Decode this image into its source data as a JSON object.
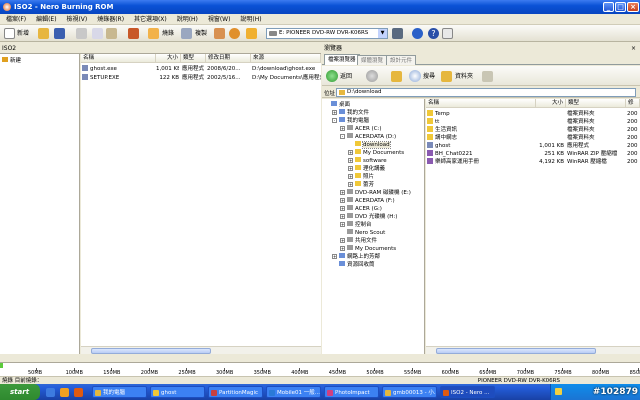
{
  "window": {
    "title": "ISO2 - Nero Burning ROM"
  },
  "menu": [
    "檔案(F)",
    "編輯(E)",
    "檢視(V)",
    "燒錄器(R)",
    "其它選項(X)",
    "說明(H)",
    "視窗(W)",
    "說明(H)"
  ],
  "toolbar": {
    "new_label": "新增",
    "burn_label": "燒錄",
    "copy_label": "複製",
    "drive": "E: PIONEER DVD-RW DVR-K06RS"
  },
  "compilation": {
    "header": "ISO2",
    "tree_root": "新建",
    "columns": [
      "名稱",
      "大小",
      "類型",
      "修改日期",
      "來源"
    ],
    "rows": [
      {
        "name": "ghost.exe",
        "size": "1,001 KB",
        "type": "應用程式",
        "date": "2008/6/20...",
        "source": "D:\\download\\ghost.exe"
      },
      {
        "name": "SETUP.EXE",
        "size": "122 KB",
        "type": "應用程式",
        "date": "2002/5/16...",
        "source": "D:\\My Documents\\應用程式"
      }
    ]
  },
  "browser": {
    "header": "瀏覽器",
    "tabs": [
      "檔案瀏覽器",
      "媒體瀏覽",
      "設計元件"
    ],
    "back_label": "返回",
    "search_label": "搜尋",
    "folders_label": "資料夾",
    "address_label": "位址",
    "address": "D:\\download",
    "tree": [
      {
        "label": "桌面",
        "level": 0,
        "exp": ""
      },
      {
        "label": "我的文件",
        "level": 1,
        "exp": "+"
      },
      {
        "label": "我的電腦",
        "level": 1,
        "exp": "-"
      },
      {
        "label": "ACER (C:)",
        "level": 2,
        "exp": "+"
      },
      {
        "label": "ACERDATA (D:)",
        "level": 2,
        "exp": "-"
      },
      {
        "label": "download",
        "level": 3,
        "exp": "",
        "sel": true
      },
      {
        "label": "My Documents",
        "level": 3,
        "exp": "+"
      },
      {
        "label": "software",
        "level": 3,
        "exp": "+"
      },
      {
        "label": "理化講義",
        "level": 3,
        "exp": "+"
      },
      {
        "label": "照片",
        "level": 3,
        "exp": "+"
      },
      {
        "label": "蕾芳",
        "level": 3,
        "exp": "+"
      },
      {
        "label": "DVD-RAM 磁碟機 (E:)",
        "level": 2,
        "exp": "+"
      },
      {
        "label": "ACERDATA (F:)",
        "level": 2,
        "exp": "+"
      },
      {
        "label": "ACER (G:)",
        "level": 2,
        "exp": "+"
      },
      {
        "label": "DVD 光碟機 (H:)",
        "level": 2,
        "exp": "+"
      },
      {
        "label": "控制台",
        "level": 2,
        "exp": "+"
      },
      {
        "label": "Nero Scout",
        "level": 2,
        "exp": ""
      },
      {
        "label": "共用文件",
        "level": 2,
        "exp": "+"
      },
      {
        "label": "My Documents",
        "level": 2,
        "exp": "+"
      },
      {
        "label": "網路上的芳鄰",
        "level": 1,
        "exp": "+"
      },
      {
        "label": "資源回收筒",
        "level": 1,
        "exp": ""
      }
    ],
    "columns": [
      "名稱",
      "大小",
      "類型",
      "修"
    ],
    "files": [
      {
        "name": "Temp",
        "size": "",
        "type": "檔案資料夾",
        "m": "200",
        "kind": "folder"
      },
      {
        "name": "tt",
        "size": "",
        "type": "檔案資料夾",
        "m": "200",
        "kind": "folder"
      },
      {
        "name": "生活資訊",
        "size": "",
        "type": "檔案資料夾",
        "m": "200",
        "kind": "folder"
      },
      {
        "name": "講中網志",
        "size": "",
        "type": "檔案資料夾",
        "m": "200",
        "kind": "folder"
      },
      {
        "name": "ghost",
        "size": "1,001 KB",
        "type": "應用程式",
        "m": "200",
        "kind": "exe"
      },
      {
        "name": "BH_Chat0221",
        "size": "251 KB",
        "type": "WinRAR ZIP 壓縮檔",
        "m": "200",
        "kind": "zip"
      },
      {
        "name": "樂師高家運用手冊",
        "size": "4,192 KB",
        "type": "WinRAR 壓縮檔",
        "m": "200",
        "kind": "rar"
      }
    ]
  },
  "capacity": {
    "used_fraction": 0.002,
    "ticks": [
      "50MB",
      "100MB",
      "150MB",
      "200MB",
      "250MB",
      "300MB",
      "350MB",
      "400MB",
      "450MB",
      "500MB",
      "550MB",
      "600MB",
      "650MB",
      "700MB",
      "750MB",
      "800MB",
      "850MB"
    ]
  },
  "status": {
    "left": "燒錄 目前燒錄：",
    "right": "PIONEER DVD-RW DVR-K06RS"
  },
  "taskbar": {
    "start": "start",
    "items": [
      "我的電腦",
      "ghost",
      "PartitionMagic",
      "Mobile01 一般...",
      "PhotoImpact",
      "gmb00013 - 小...",
      "ISO2 - Nero ..."
    ],
    "watermark": "#102879"
  },
  "colors": {
    "accent": "#0a52d6",
    "used": "#5ccb3c",
    "folder": "#f0c838"
  }
}
